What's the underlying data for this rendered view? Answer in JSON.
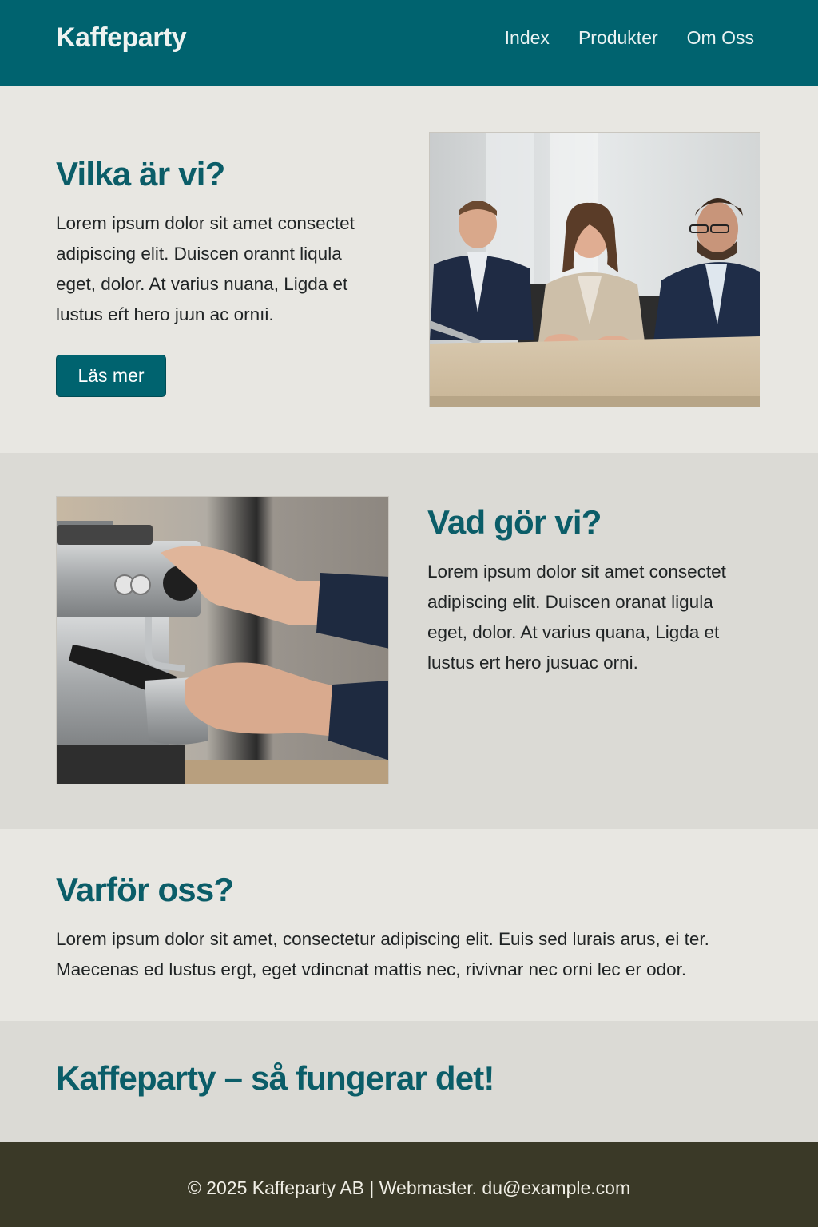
{
  "header": {
    "logo": "Kaffeparty",
    "nav": [
      "Index",
      "Produkter",
      "Om Oss"
    ]
  },
  "who": {
    "title": "Vilka är vi?",
    "lines": [
      "Lorem ipsum dolor sit amet consectet",
      "adipiscing elit. Duiscen orannt liqula",
      "eget, dolor. At varius nuana, Ligda et",
      "lustus eŕt hero juɹn ac ornıi."
    ],
    "button": "Läs mer",
    "image": "team-meeting-photo"
  },
  "what": {
    "title": "Vad gör vi?",
    "lines": [
      "Lorem ipsum dolor sit amet consectet",
      "adipiscing elit. Duiscen oranat ligula",
      "eget, dolor. At varius quana, Ligda et",
      "lustus ert hero jusuac orni."
    ],
    "image": "espresso-machine-photo"
  },
  "why": {
    "title": "Varför oss?",
    "lines": [
      "Lorem ipsum dolor sit amet, consectetur adipiscing elit. Euis sed lurais arus, ei ter.",
      "Maecenas ed lustus ergt, eget vdincnat mattis nec, rivivnar nec orni lec er odor."
    ]
  },
  "how": {
    "title": "Kaffeparty – så fungerar det!"
  },
  "footer": {
    "text": "© 2025 Kaffeparty AB | Webmaster. du@example.com"
  },
  "colors": {
    "primary": "#00636f",
    "heading": "#0b5d68",
    "footer_bg": "#3a3927"
  }
}
